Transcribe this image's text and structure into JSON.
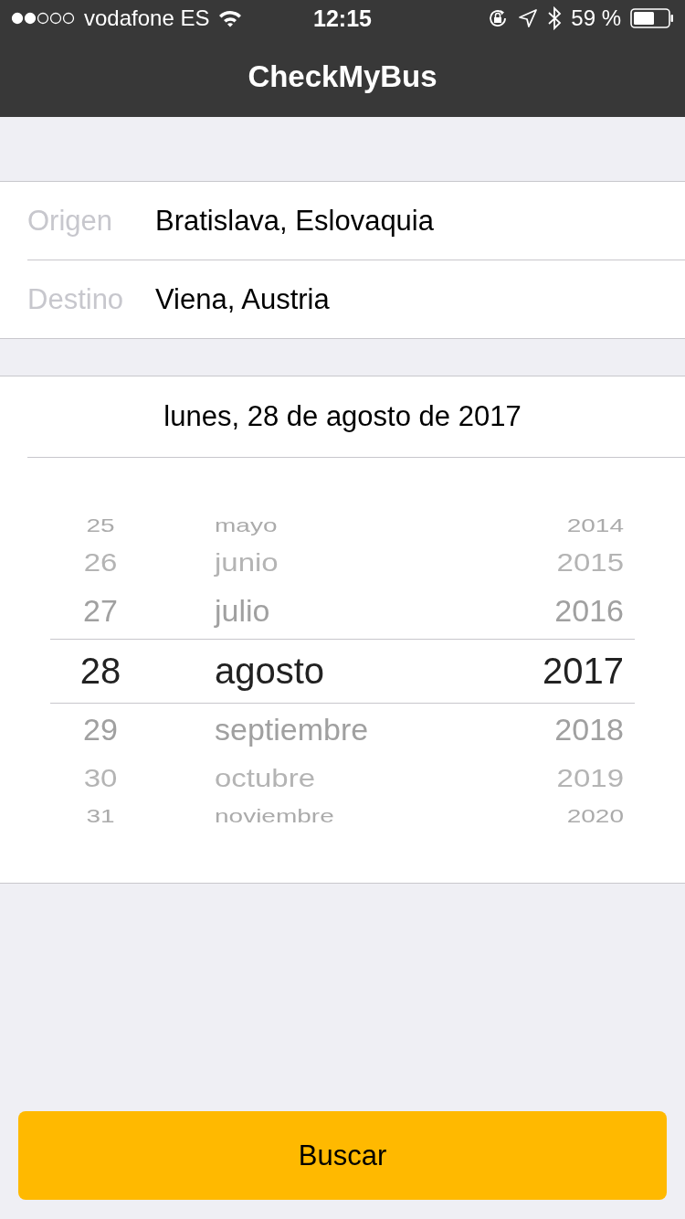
{
  "status_bar": {
    "carrier": "vodafone ES",
    "time": "12:15",
    "battery": "59 %"
  },
  "nav": {
    "title": "CheckMyBus"
  },
  "form": [
    {
      "label": "Origen",
      "value": "Bratislava, Eslovaquia"
    },
    {
      "label": "Destino",
      "value": "Viena, Austria"
    }
  ],
  "date": {
    "text": "lunes, 28 de agosto de 2017"
  },
  "picker": {
    "columns": [
      {
        "kind": "day",
        "items": [
          {
            "text": "25",
            "selected": false
          },
          {
            "text": "26",
            "selected": false
          },
          {
            "text": "27",
            "selected": false
          },
          {
            "text": "28",
            "selected": true
          },
          {
            "text": "29",
            "selected": false
          },
          {
            "text": "30",
            "selected": false
          },
          {
            "text": "31",
            "selected": false
          }
        ]
      },
      {
        "kind": "month",
        "items": [
          {
            "text": "mayo",
            "selected": false
          },
          {
            "text": "junio",
            "selected": false
          },
          {
            "text": "julio",
            "selected": false
          },
          {
            "text": "agosto",
            "selected": true
          },
          {
            "text": "septiembre",
            "selected": false
          },
          {
            "text": "octubre",
            "selected": false
          },
          {
            "text": "noviembre",
            "selected": false
          }
        ]
      },
      {
        "kind": "year",
        "items": [
          {
            "text": "2014",
            "selected": false
          },
          {
            "text": "2015",
            "selected": false
          },
          {
            "text": "2016",
            "selected": false
          },
          {
            "text": "2017",
            "selected": true
          },
          {
            "text": "2018",
            "selected": false
          },
          {
            "text": "2019",
            "selected": false
          },
          {
            "text": "2020",
            "selected": false
          }
        ]
      }
    ]
  },
  "button": {
    "label": "Buscar"
  }
}
